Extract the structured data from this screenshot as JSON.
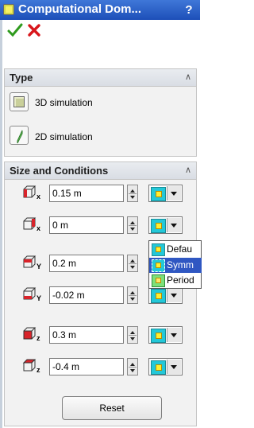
{
  "window": {
    "title": "Computational Dom...",
    "help": "?"
  },
  "toolbar": {
    "ok_icon": "check-icon",
    "cancel_icon": "x-icon"
  },
  "type_panel": {
    "title": "Type",
    "options": [
      {
        "label": "3D simulation",
        "icon": "3d-simulation-icon"
      },
      {
        "label": "2D simulation",
        "icon": "2d-simulation-icon"
      }
    ]
  },
  "size_panel": {
    "title": "Size and Conditions",
    "rows": [
      {
        "axis": "x",
        "value": "0.15 m"
      },
      {
        "axis": "x",
        "value": "0 m"
      },
      {
        "axis": "Y",
        "value": "0.2 m"
      },
      {
        "axis": "Y",
        "value": "-0.02 m"
      },
      {
        "axis": "z",
        "value": "0.3 m"
      },
      {
        "axis": "z",
        "value": "-0.4 m"
      }
    ]
  },
  "boundary_dropdown": {
    "items": [
      {
        "label": "Defau",
        "selected": false
      },
      {
        "label": "Symm",
        "selected": true
      },
      {
        "label": "Period",
        "selected": false
      }
    ]
  },
  "reset_label": "Reset",
  "colors": {
    "title_bar": "#2b62c8",
    "swatch": "#23c8d8",
    "selection": "#2f57c2"
  }
}
